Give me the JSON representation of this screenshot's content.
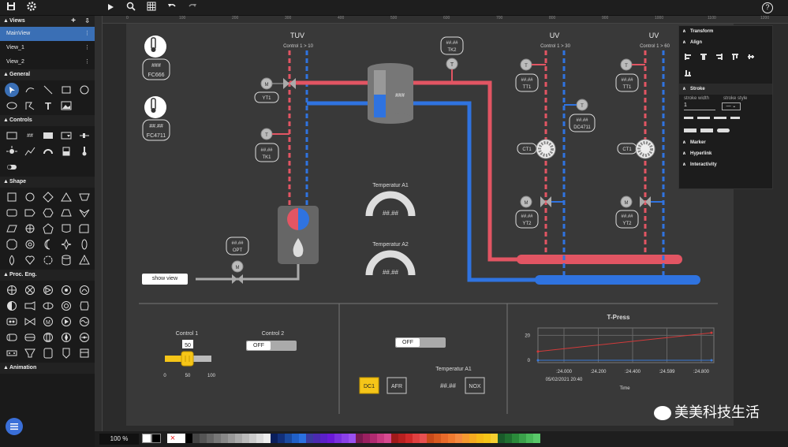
{
  "toolbar": {
    "help": "?"
  },
  "sidebar": {
    "views_title": "Views",
    "views": [
      {
        "label": "MainView"
      },
      {
        "label": "View_1"
      },
      {
        "label": "View_2"
      }
    ],
    "sections": {
      "general": "General",
      "controls": "Controls",
      "shape": "Shape",
      "proc": "Proc. Eng.",
      "animation": "Animation"
    }
  },
  "ruler": {
    "ticks": [
      "0",
      "100",
      "200",
      "300",
      "400",
      "500",
      "600",
      "700",
      "800",
      "900",
      "1000",
      "1100",
      "1200",
      "1300"
    ]
  },
  "canvas": {
    "tuv_title": "TUV",
    "tuv_sub": "Control 1 > 10",
    "uv1_title": "UV",
    "uv1_sub": "Control 1 > 30",
    "uv2_title": "UV",
    "uv2_sub": "Control 1 > 60",
    "hash3": "###",
    "hash4": "##.##",
    "tk2": "TK2",
    "fc666": "FC666",
    "fc4711": "FC4711",
    "yt1": "YT1",
    "tk1": "TK1",
    "opt": "OPT",
    "tt1a": "TT1",
    "tt1b": "TT1",
    "dc4711": "DC4711",
    "ct1a": "CT1",
    "ct1b": "CT1",
    "yt2a": "YT2",
    "yt2b": "YT2",
    "temp_a1": "Temperatur A1",
    "temp_a2": "Temperatur A2",
    "gauge_val": "##.##",
    "tank_val": "###",
    "show_view": "show view",
    "control1": "Control 1",
    "control1_val": "50",
    "slider_min": "0",
    "slider_mid": "50",
    "slider_max": "100",
    "control2": "Control 2",
    "off": "OFF",
    "temp_a1_bottom": "Temperatur A1",
    "dc1": "DC1",
    "afr": "AFR",
    "nox": "NOX",
    "val_hash": "##.##"
  },
  "chart_data": {
    "type": "line",
    "title": "T-Press",
    "xlabel": "Time",
    "ylabel": "",
    "x": [
      ":24.000",
      ":24.200",
      ":24.400",
      ":24.599",
      ":24.800"
    ],
    "date_label": "05/02/2021 20:40",
    "yticks": [
      "20",
      "0"
    ],
    "series": [
      {
        "values": [
          7,
          22
        ],
        "color": "#d23a3a"
      },
      {
        "values": [
          0,
          0
        ],
        "color": "#3a7ad8"
      }
    ]
  },
  "props": {
    "transform": "Transform",
    "align": "Align",
    "stroke": "Stroke",
    "stroke_width_label": "stroke width",
    "stroke_style_label": "stroke style",
    "stroke_width_value": "1",
    "marker": "Marker",
    "hyperlink": "Hyperlink",
    "interactivity": "Interactivity"
  },
  "bottom": {
    "zoom": "100 %"
  },
  "watermark": "美美科技生活",
  "colors": {
    "hot": "#e25563",
    "cold": "#2f73e0",
    "accent": "#f5c518",
    "selected": "#3a6fb5"
  }
}
